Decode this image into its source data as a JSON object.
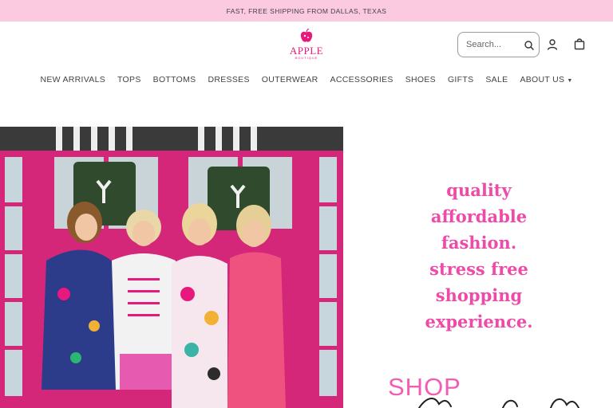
{
  "announcement": {
    "text": "FAST, FREE SHIPPING FROM DALLAS, TEXAS"
  },
  "brand": {
    "name": "APPLE",
    "subtitle": "BOUTIQUE",
    "color": "#e8197c"
  },
  "header": {
    "search_placeholder": "Search...",
    "icons": [
      "search-icon",
      "user-icon",
      "shopping-bag-icon"
    ]
  },
  "nav": {
    "items": [
      {
        "label": "NEW ARRIVALS"
      },
      {
        "label": "TOPS"
      },
      {
        "label": "BOTTOMS"
      },
      {
        "label": "DRESSES"
      },
      {
        "label": "OUTERWEAR"
      },
      {
        "label": "ACCESSORIES"
      },
      {
        "label": "SHOES"
      },
      {
        "label": "GIFTS"
      },
      {
        "label": "SALE"
      },
      {
        "label": "ABOUT US"
      }
    ]
  },
  "hero": {
    "tagline": [
      "quality",
      "affordable",
      "fashion.",
      "stress free",
      "shopping",
      "experience."
    ],
    "shop_label": "SHOP",
    "accent_color": "#ee4aa8"
  },
  "colors": {
    "announce_bg": "#fbc9e0",
    "door_pink": "#d4277a"
  }
}
